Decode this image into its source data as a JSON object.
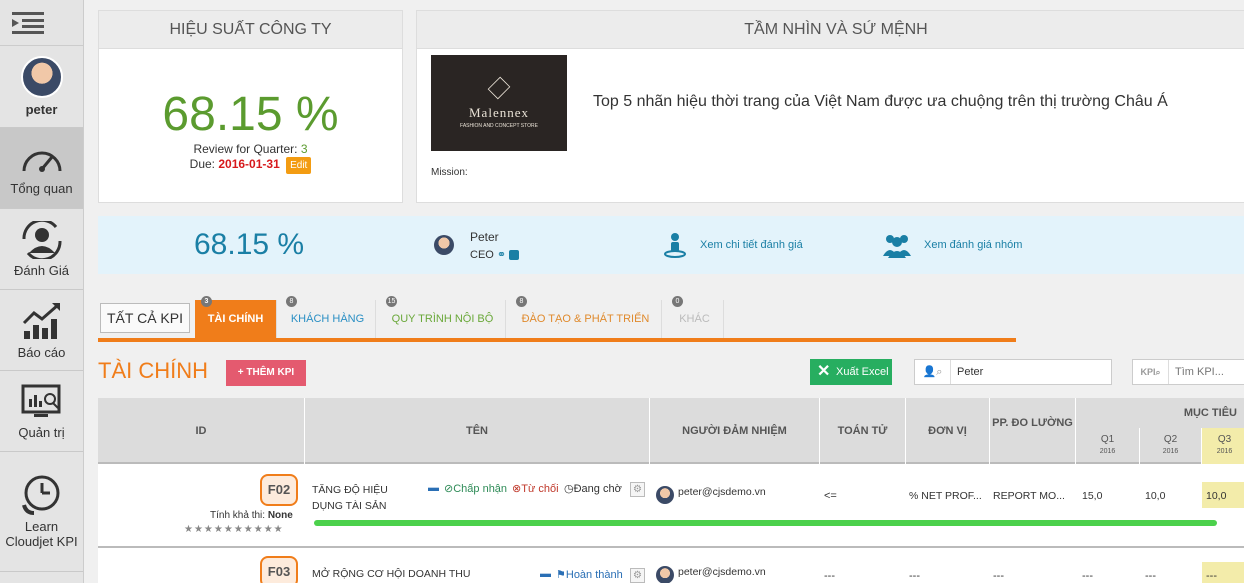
{
  "sidebar": {
    "user_name": "peter",
    "items": [
      {
        "label": "Tổng quan",
        "icon": "dashboard-gauge-icon"
      },
      {
        "label": "Đánh Giá",
        "icon": "user-review-icon"
      },
      {
        "label": "Báo cáo",
        "icon": "chart-growth-icon"
      },
      {
        "label": "Quản trị",
        "icon": "admin-monitor-icon"
      },
      {
        "label": "Learn Cloudjet KPI",
        "icon": "learn-clock-phone-icon"
      }
    ]
  },
  "performance": {
    "title": "HIỆU SUẤT CÔNG TY",
    "value": "68.15 %",
    "review_label": "Review for Quarter:",
    "quarter": "3",
    "due_label": "Due:",
    "due_date": "2016-01-31",
    "edit_label": "Edit"
  },
  "vision": {
    "title": "TẦM NHÌN VÀ SỨ MỆNH",
    "logo_name": "Malennex",
    "logo_tagline": "FASHION AND CONCEPT STORE",
    "statement": "Top 5 nhãn hiệu thời trang của Việt Nam được ưa chuộng trên thị trường Châu Á",
    "mission_label": "Mission:"
  },
  "summary": {
    "value": "68.15 %",
    "person_name": "Peter",
    "person_role": "CEO",
    "link_detail": "Xem chi tiết đánh giá",
    "link_group": "Xem đánh giá nhóm"
  },
  "tabs": {
    "all_label": "TẤT CẢ KPI",
    "items": [
      {
        "label": "TÀI CHÍNH",
        "count": "3",
        "color": "#f07d1a"
      },
      {
        "label": "KHÁCH HÀNG",
        "count": "8",
        "color": "#2a8fc4"
      },
      {
        "label": "QUY TRÌNH NỘI BỘ",
        "count": "15",
        "color": "#6aa83a"
      },
      {
        "label": "ĐÀO TẠO & PHÁT TRIỂN",
        "count": "8",
        "color": "#e08a2d"
      },
      {
        "label": "KHÁC",
        "count": "0",
        "color": "#bbbbbb"
      }
    ]
  },
  "section": {
    "title": "TÀI CHÍNH",
    "add_kpi": "+ THÊM KPI",
    "excel": "Xuất Excel",
    "search_value": "Peter",
    "kpi_search_prefix": "KPI",
    "kpi_search_placeholder": "Tìm KPI..."
  },
  "table": {
    "headers": {
      "id": "ID",
      "name": "TÊN",
      "owner": "NGƯỜI ĐẢM NHIỆM",
      "operator": "TOÁN TỬ",
      "unit": "ĐƠN VỊ",
      "measure": "PP. ĐO LƯỜNG",
      "target": "MỤC TIÊU",
      "q1": "Q1",
      "q2": "Q2",
      "q3": "Q3",
      "year": "2016"
    },
    "rows": [
      {
        "id": "F02",
        "feasibility_label": "Tính khả thi:",
        "feasibility": "None",
        "stars": "★★★★★★★★★★",
        "name": "TĂNG ĐỘ HIỆU DỤNG TÀI SẢN",
        "status_accept": "Chấp nhận",
        "status_reject": "Từ chối",
        "status_pending": "Đang chờ",
        "owner": "peter@cjsdemo.vn",
        "operator": "<=",
        "unit": "% NET PROF...",
        "measure": "REPORT MO...",
        "q1": "15,0",
        "q2": "10,0",
        "q3": "10,0",
        "progress": 0.86
      },
      {
        "id": "F03",
        "name": "MỞ RỘNG CƠ HỘI DOANH THU",
        "status_done": "Hoàn thành",
        "owner": "peter@cjsdemo.vn",
        "operator": "---",
        "unit": "---",
        "measure": "---",
        "q1": "---",
        "q2": "---",
        "q3": "---"
      }
    ]
  }
}
